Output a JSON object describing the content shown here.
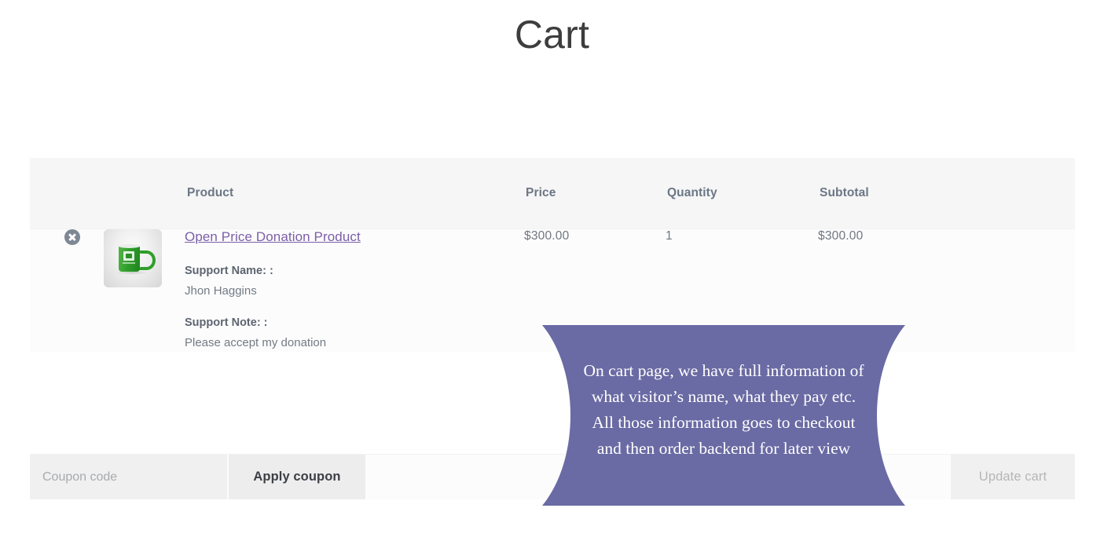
{
  "page": {
    "title": "Cart",
    "accent_purple": "#7b5ea7",
    "callout_fill": "#6a6aa4",
    "header_bg": "#f6f6f6",
    "row_bg": "#fcfcfc"
  },
  "cart_table": {
    "headers": {
      "remove": "",
      "thumbnail": "",
      "product": "Product",
      "price": "Price",
      "quantity": "Quantity",
      "subtotal": "Subtotal"
    },
    "rows": [
      {
        "remove_icon": "close-circle-icon",
        "thumbnail_icon": "green-mug-product-thumbnail",
        "product_name": "Open Price Donation Product",
        "meta": [
          {
            "label": "Support Name: :",
            "value": "Jhon Haggins"
          },
          {
            "label": "Support Note: :",
            "value": "Please accept my donation"
          }
        ],
        "price": "$300.00",
        "quantity": "1",
        "subtotal": "$300.00"
      }
    ]
  },
  "actions": {
    "coupon_placeholder": "Coupon code",
    "coupon_value": "",
    "apply_coupon_label": "Apply coupon",
    "update_cart_label": "Update cart"
  },
  "callout": {
    "lines": [
      "On cart page, we have full information of",
      "what visitor’s name, what they pay etc.",
      "All those information goes to checkout",
      "and then order backend for later view"
    ]
  }
}
